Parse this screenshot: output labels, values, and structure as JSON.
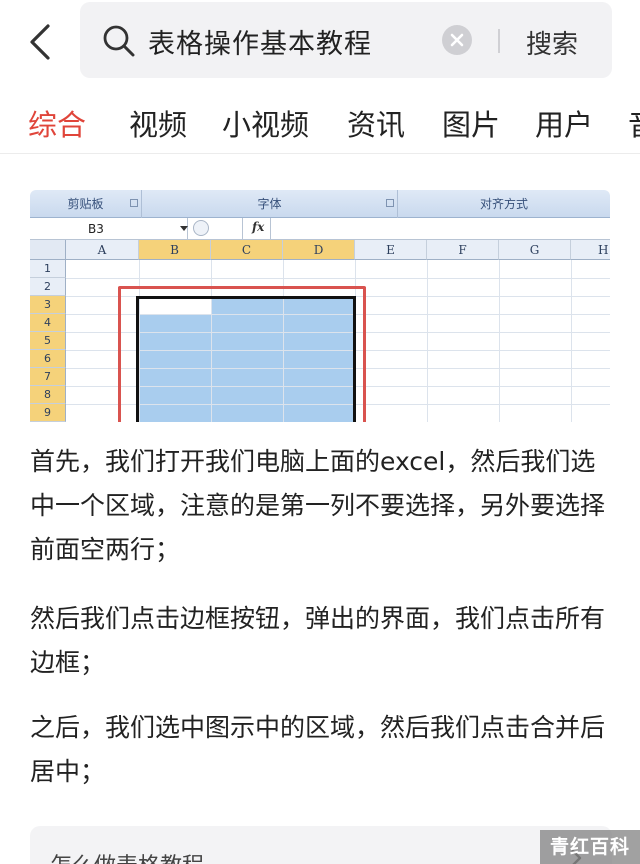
{
  "search": {
    "query": "表格操作基本教程",
    "button": "搜索"
  },
  "tabs": [
    {
      "label": "综合",
      "active": true
    },
    {
      "label": "视频"
    },
    {
      "label": "小视频"
    },
    {
      "label": "资讯"
    },
    {
      "label": "图片"
    },
    {
      "label": "用户"
    },
    {
      "label": "音"
    }
  ],
  "excel": {
    "ribbon_groups": [
      "剪贴板",
      "字体",
      "对齐方式"
    ],
    "name_box": "B3",
    "fx_label": "fx",
    "columns": [
      "A",
      "B",
      "C",
      "D",
      "E",
      "F",
      "G",
      "H"
    ],
    "selected_columns": [
      "B",
      "C",
      "D"
    ],
    "rows": [
      "1",
      "2",
      "3",
      "4",
      "5",
      "6",
      "7",
      "8",
      "9"
    ],
    "selected_rows": [
      "3",
      "4",
      "5",
      "6",
      "7",
      "8",
      "9"
    ]
  },
  "article": {
    "paragraphs": [
      "首先，我们打开我们电脑上面的excel，然后我们选中一个区域，注意的是第一列不要选择，另外要选择前面空两行；",
      "然后我们点击边框按钮，弹出的界面，我们点击所有边框；",
      "之后，我们选中图示中的区域，然后我们点击合并后居中；"
    ]
  },
  "related": {
    "title": "怎么做表格教程"
  },
  "watermark": "青红百科",
  "colors": {
    "accent": "#e0453a",
    "selection": "#a9cdee",
    "highlight_header": "#f5d27a",
    "red_frame": "#d9534f"
  }
}
